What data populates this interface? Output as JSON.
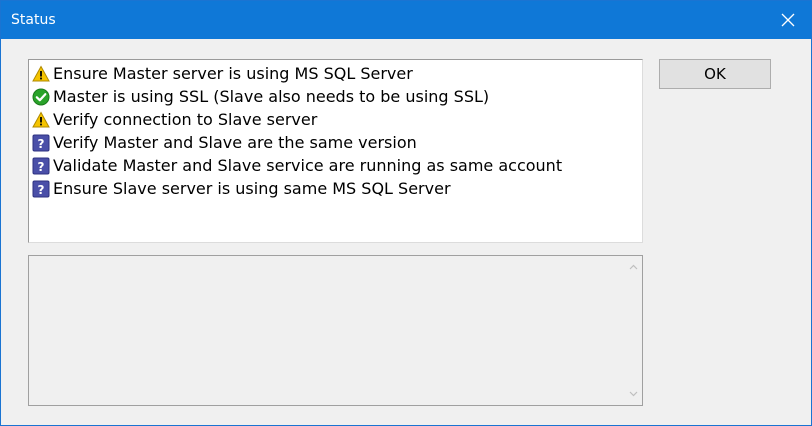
{
  "window": {
    "title": "Status"
  },
  "status_list": {
    "items": [
      {
        "icon": "warning-icon",
        "label": "Ensure Master server is using MS SQL Server"
      },
      {
        "icon": "success-check-icon",
        "label": "Master is using SSL (Slave also needs to be using SSL)"
      },
      {
        "icon": "warning-icon",
        "label": "Verify connection to Slave server"
      },
      {
        "icon": "question-icon",
        "label": "Verify Master and Slave are the same version"
      },
      {
        "icon": "question-icon",
        "label": "Validate Master and Slave service are running as same account"
      },
      {
        "icon": "question-icon",
        "label": "Ensure Slave server is using same MS SQL Server"
      }
    ]
  },
  "buttons": {
    "ok_label": "OK"
  },
  "details": {
    "text": ""
  },
  "colors": {
    "titlebar": "#0f78d7",
    "warning": "#f5c400",
    "success": "#2aa32a",
    "question": "#4a4fa8"
  }
}
